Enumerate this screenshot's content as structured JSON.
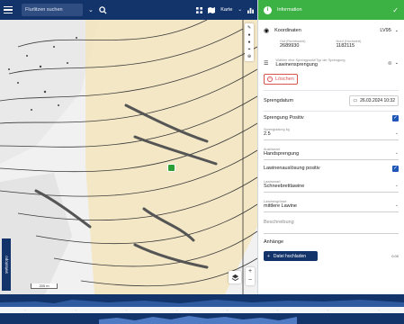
{
  "topbar": {
    "search_placeholder": "Flurlitzen suchen",
    "map_label": "Karte"
  },
  "map": {
    "brand": "swisstopo",
    "scale": "200 m"
  },
  "panel": {
    "title": "Information",
    "coordinates": {
      "label": "Koordinaten",
      "system": "LV95",
      "east_label": "Ost (Rechtswert)",
      "east": "2689930",
      "north_label": "Nord (Hochwert)",
      "north": "1182115"
    },
    "point_select": {
      "label": "Wählen eine Sprengpunkt/Typ der Sprengung",
      "value": "Lawinensprengung"
    },
    "delete_label": "Löschen",
    "sprengdatum_label": "Sprengdatum",
    "sprengdatum_value": "26.03.2024 10:32",
    "sprengung_positiv_label": "Sprengung Positiv",
    "sprengladung": {
      "label": "Sprengladung kg",
      "value": "2.5"
    },
    "auslosart": {
      "label": "Auslöseart",
      "value": "Handsprengung"
    },
    "lawinenauslosung_label": "Lawinenauslösung positiv",
    "lawinenart": {
      "label": "Lawinenart",
      "value": "Schneebrettlawine"
    },
    "lawinengrosse": {
      "label": "Lawinengrösse",
      "value": "mittlere Lawine"
    },
    "beschreibung_label": "Beschreibung",
    "anhange_label": "Anhänge",
    "upload_label": "Datei hochladen",
    "upload_size": "0.00"
  }
}
